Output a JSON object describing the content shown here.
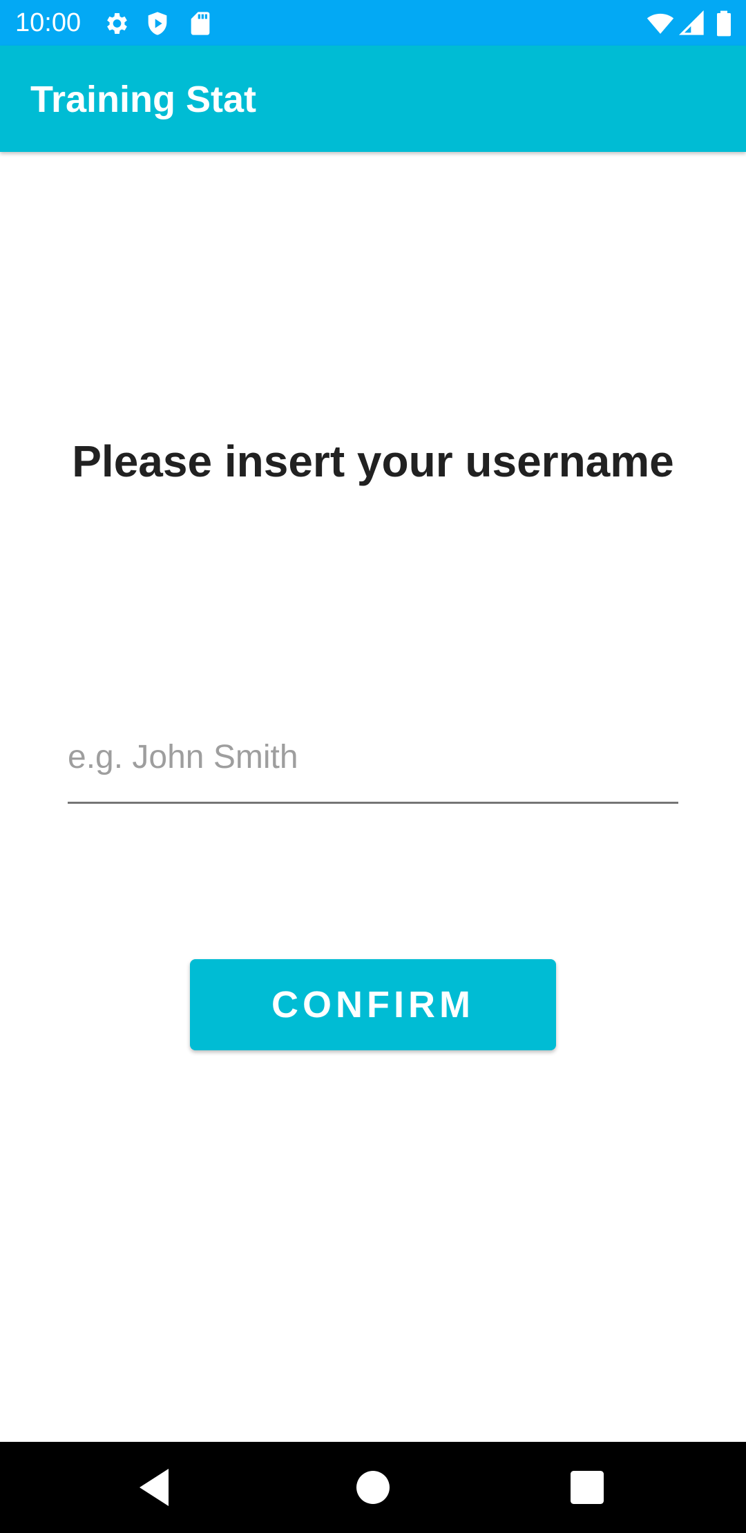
{
  "status_bar": {
    "time": "10:00",
    "background_color": "#03A9F4",
    "icons_left": [
      "gear-icon",
      "shield-icon",
      "sd-card-icon"
    ],
    "icons_right": [
      "wifi-icon",
      "signal-icon",
      "battery-icon"
    ]
  },
  "app_bar": {
    "title": "Training Stat",
    "background_color": "#00BCD4"
  },
  "main": {
    "prompt": "Please insert your username",
    "username_input": {
      "value": "",
      "placeholder": "e.g. John Smith"
    },
    "confirm_label": "CONFIRM",
    "confirm_color": "#00BCD4"
  },
  "nav_bar": {
    "buttons": [
      "back-icon",
      "home-icon",
      "recents-icon"
    ]
  }
}
